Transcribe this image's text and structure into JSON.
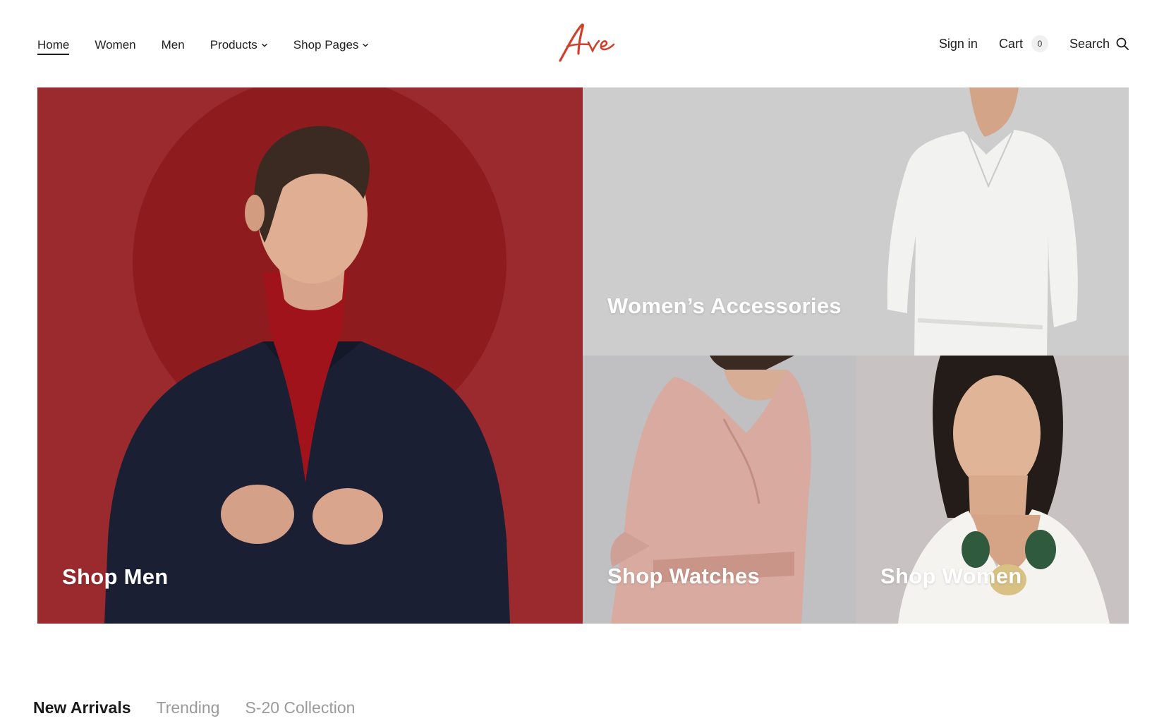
{
  "nav": {
    "items": [
      {
        "label": "Home",
        "active": true
      },
      {
        "label": "Women"
      },
      {
        "label": "Men"
      },
      {
        "label": "Products",
        "dropdown": true
      },
      {
        "label": "Shop Pages",
        "dropdown": true
      }
    ]
  },
  "logo": {
    "text": "Ave",
    "color": "#d0402a"
  },
  "header_right": {
    "signin": "Sign in",
    "cart": "Cart",
    "cart_count": "0",
    "search": "Search"
  },
  "tiles": {
    "men": "Shop Men",
    "accessories": "Women’s Accessories",
    "watches": "Shop Watches",
    "women": "Shop Women"
  },
  "tabs": [
    {
      "label": "New Arrivals",
      "active": true
    },
    {
      "label": "Trending"
    },
    {
      "label": "S-20 Collection"
    }
  ],
  "colors": {
    "men_bg": "#9a2a2d",
    "accessories_bg": "#cdcdcd",
    "watches_bg": "#c0bfc1",
    "women_bg": "#c9c2c2"
  }
}
